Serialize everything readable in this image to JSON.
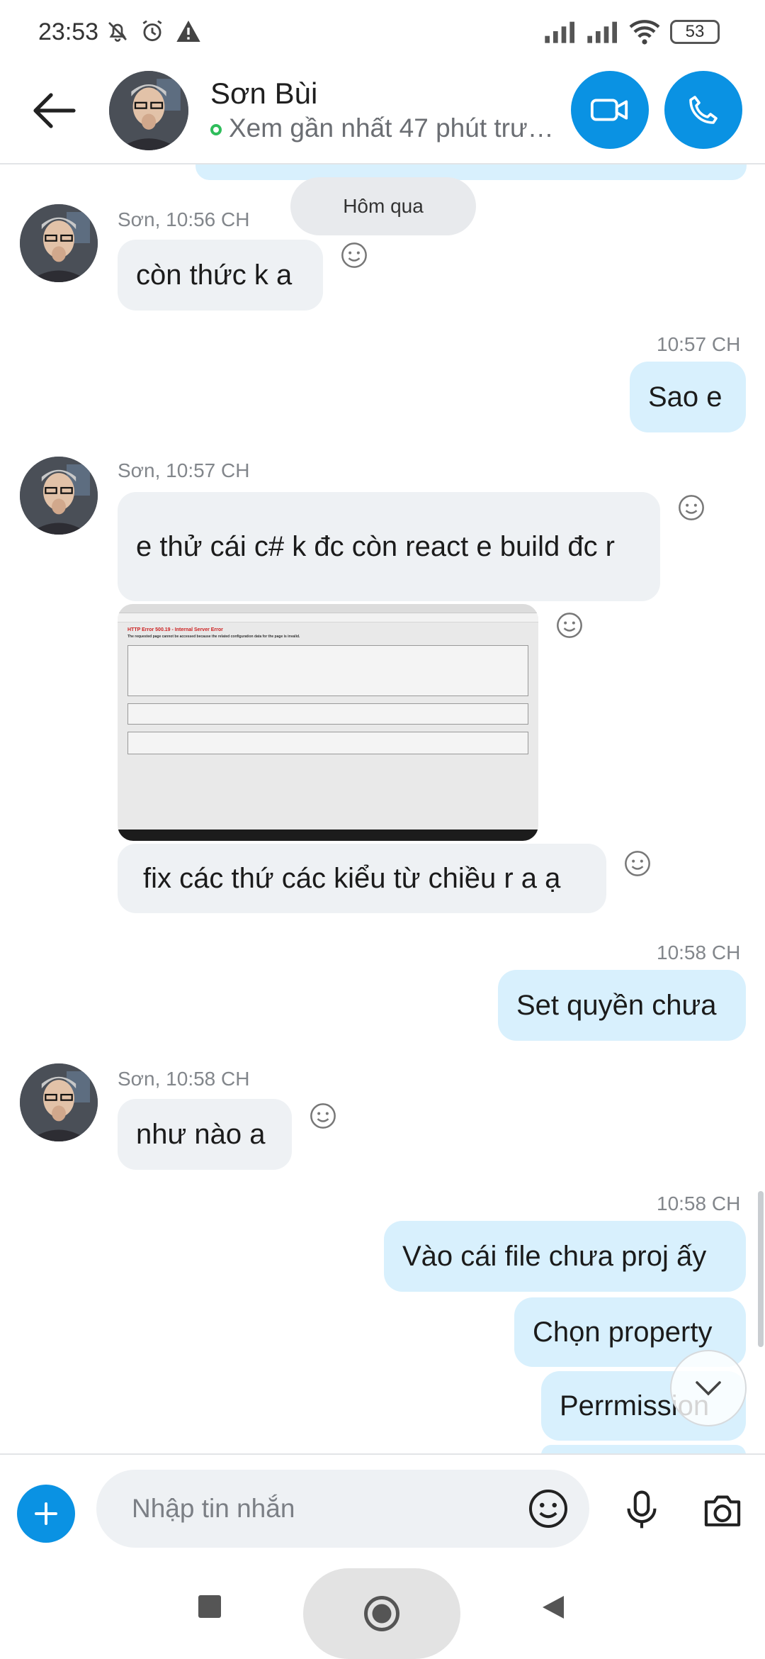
{
  "status_bar": {
    "time": "23:53",
    "battery": "53"
  },
  "header": {
    "contact_name": "Sơn Bùi",
    "presence": "Xem gần nhất 47 phút trư…"
  },
  "chat": {
    "date_separator": "Hôm qua",
    "messages": [
      {
        "sender": "Sơn",
        "meta": "Sơn, 10:56 CH",
        "text": "còn thức k a"
      },
      {
        "sender": "me",
        "meta": "10:57 CH",
        "text": "Sao e"
      },
      {
        "sender": "Sơn",
        "meta": "Sơn, 10:57 CH",
        "text": "e thử cái c# k đc còn react e build đc r"
      },
      {
        "sender": "Sơn",
        "attachment": "image",
        "error_title": "HTTP Error 500.19 - Internal Server Error",
        "error_subtitle": "The requested page cannot be accessed because the related configuration data for the page is invalid."
      },
      {
        "sender": "Sơn",
        "text": "fix các thứ các kiểu từ chiều r a ạ"
      },
      {
        "sender": "me",
        "meta": "10:58 CH",
        "text": "Set quyền chưa"
      },
      {
        "sender": "Sơn",
        "meta": "Sơn, 10:58 CH",
        "text": "như nào a"
      },
      {
        "sender": "me",
        "meta": "10:58 CH",
        "text": "Vào cái file chưa proj ấy"
      },
      {
        "sender": "me",
        "text": "Chọn property"
      },
      {
        "sender": "me",
        "text": "Perrmission"
      }
    ]
  },
  "composer": {
    "placeholder": "Nhập tin nhắn"
  },
  "colors": {
    "accent": "#0a92e3",
    "outgoing_bubble": "#d8f0fd",
    "incoming_bubble": "#eef1f4",
    "online": "#2fbd5b"
  },
  "icons": [
    "back-arrow-icon",
    "video-call-icon",
    "phone-call-icon",
    "emoji-reaction-icon",
    "add-icon",
    "emoji-icon",
    "microphone-icon",
    "camera-icon",
    "scroll-down-icon",
    "nav-recents-icon",
    "nav-home-icon",
    "nav-back-icon"
  ]
}
